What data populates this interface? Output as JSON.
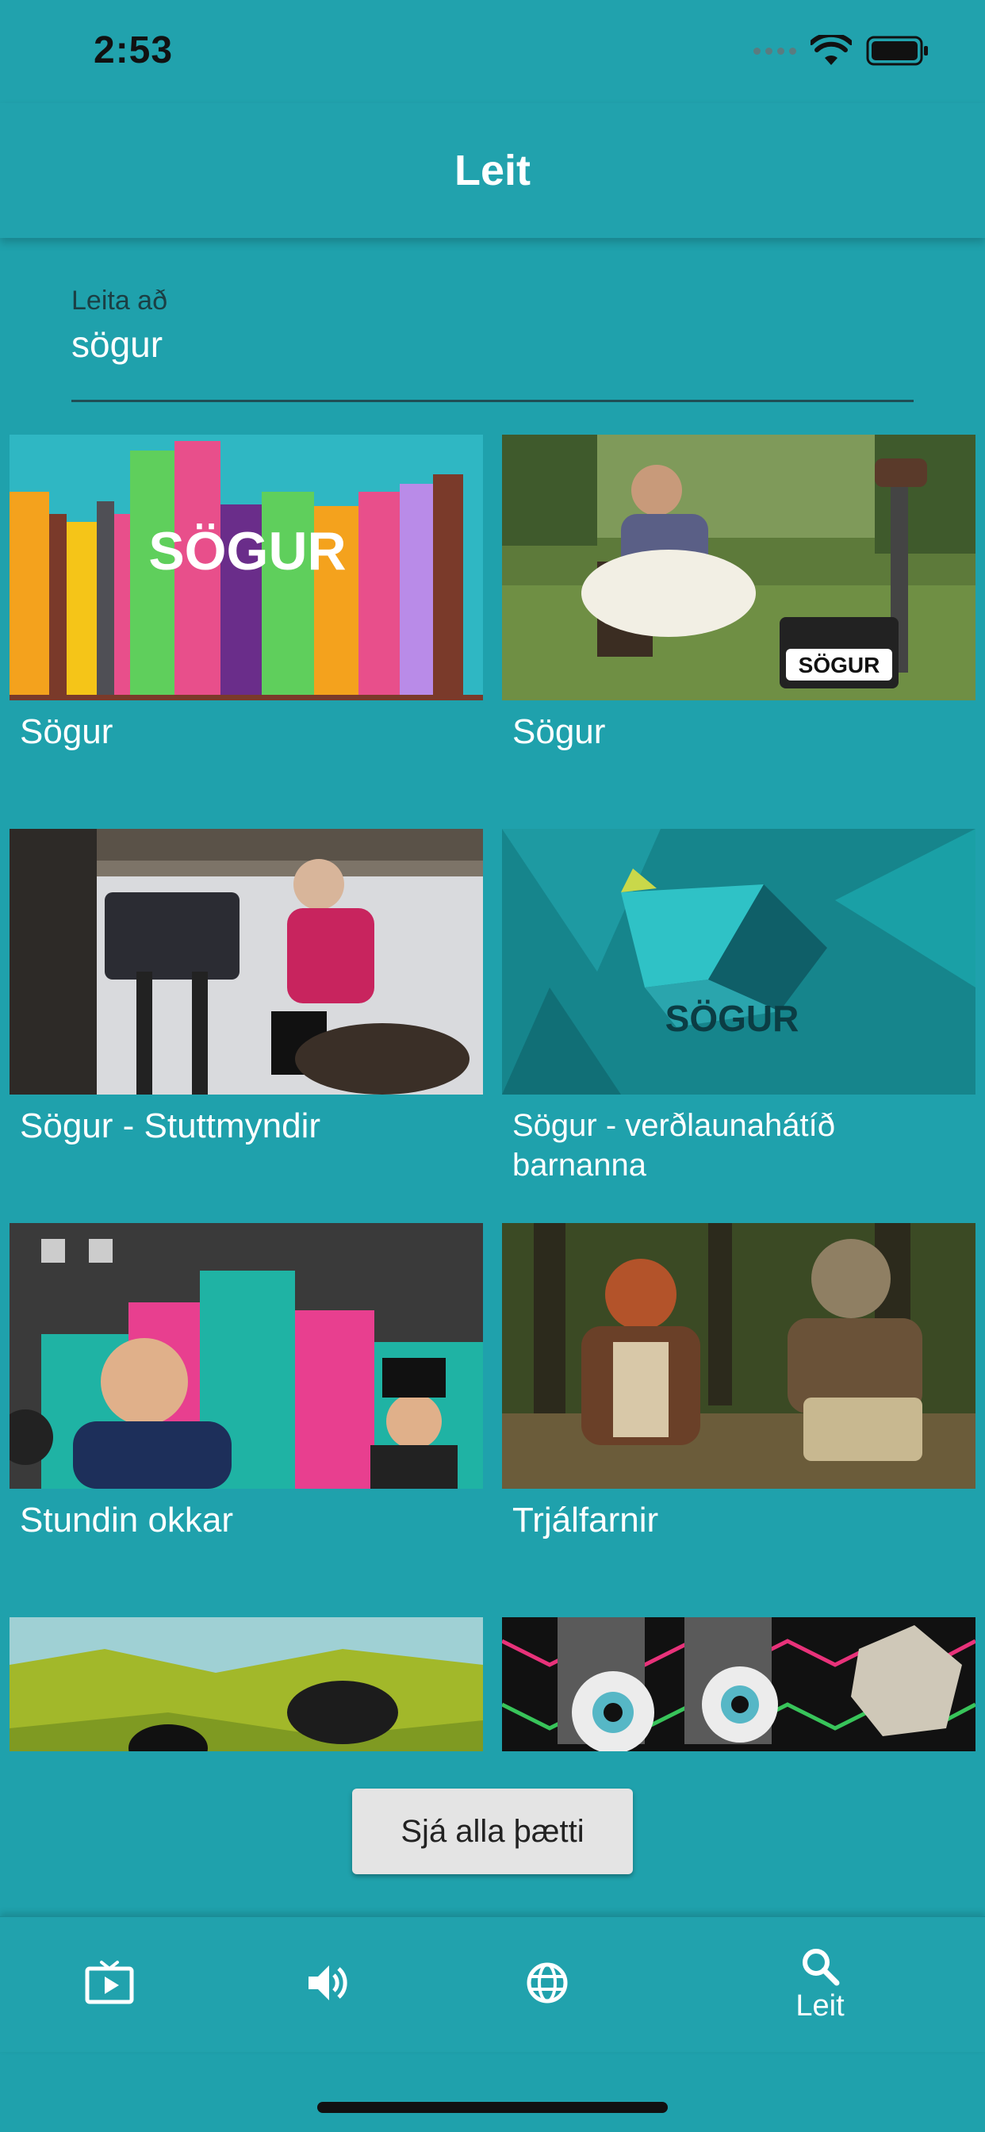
{
  "status_bar": {
    "time": "2:53"
  },
  "header": {
    "title": "Leit"
  },
  "search": {
    "label": "Leita að",
    "value": "sögur"
  },
  "results": [
    {
      "title": "Sögur",
      "thumb_text": "SÖGUR"
    },
    {
      "title": "Sögur",
      "thumb_text": "SÖGUR"
    },
    {
      "title": "Sögur - Stuttmyndir"
    },
    {
      "title": "Sögur - verðlaunahátíð barnanna",
      "thumb_text": "SÖGUR"
    },
    {
      "title": "Stundin okkar"
    },
    {
      "title": "Trjálfarnir"
    },
    {
      "title": ""
    },
    {
      "title": ""
    }
  ],
  "see_all_label": "Sjá alla þætti",
  "bottom_nav": [
    {
      "icon": "tv-play-icon",
      "label": ""
    },
    {
      "icon": "speaker-icon",
      "label": ""
    },
    {
      "icon": "globe-icon",
      "label": ""
    },
    {
      "icon": "search-icon",
      "label": "Leit"
    }
  ],
  "colors": {
    "background": "#1fa1ac",
    "text": "#ffffff",
    "button": "#e4e4e4"
  }
}
